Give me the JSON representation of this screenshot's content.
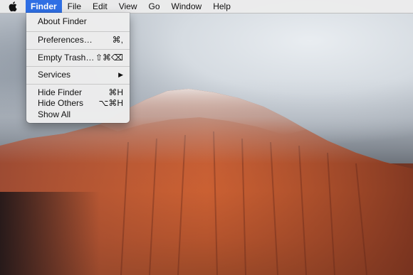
{
  "menubar": {
    "items": [
      {
        "label": "Finder",
        "active": true
      },
      {
        "label": "File"
      },
      {
        "label": "Edit"
      },
      {
        "label": "View"
      },
      {
        "label": "Go"
      },
      {
        "label": "Window"
      },
      {
        "label": "Help"
      }
    ],
    "accent_color": "#2f6fe4",
    "apple_icon": "apple-logo-icon"
  },
  "finder_menu": {
    "about": "About Finder",
    "preferences": {
      "label": "Preferences…",
      "shortcut": "⌘,"
    },
    "empty_trash": {
      "label": "Empty Trash…",
      "shortcut": "⇧⌘⌫"
    },
    "services": {
      "label": "Services",
      "arrow": "▶"
    },
    "hide_finder": {
      "label": "Hide Finder",
      "shortcut": "⌘H"
    },
    "hide_others": {
      "label": "Hide Others",
      "shortcut": "⌥⌘H"
    },
    "show_all": "Show All"
  }
}
